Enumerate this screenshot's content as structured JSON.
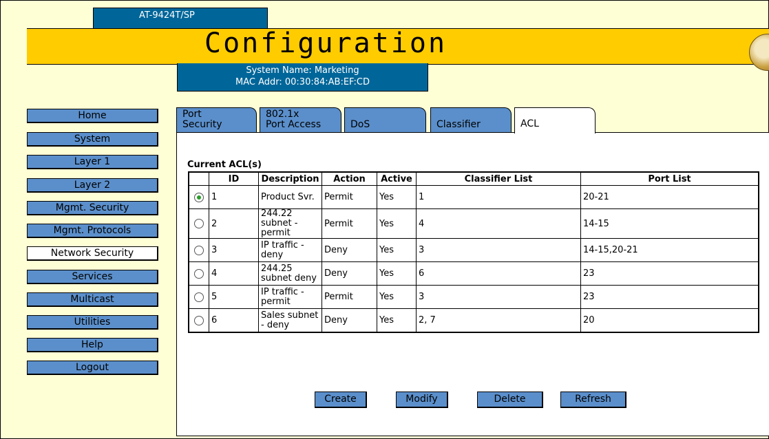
{
  "header": {
    "model": "AT-9424T/SP",
    "title": "Configuration",
    "system_name": "System Name: Marketing",
    "mac_addr": "MAC Addr: 00:30:84:AB:EF:CD"
  },
  "sidebar": {
    "items": [
      {
        "label": "Home"
      },
      {
        "label": "System"
      },
      {
        "label": "Layer 1"
      },
      {
        "label": "Layer 2"
      },
      {
        "label": "Mgmt. Security"
      },
      {
        "label": "Mgmt. Protocols"
      },
      {
        "label": "Network Security",
        "active": true
      },
      {
        "label": "Services"
      },
      {
        "label": "Multicast"
      },
      {
        "label": "Utilities"
      },
      {
        "label": "Help"
      },
      {
        "label": "Logout"
      }
    ]
  },
  "tabs": [
    {
      "line1": "Port",
      "line2": "Security"
    },
    {
      "line1": "802.1x",
      "line2": "Port Access"
    },
    {
      "line1": "",
      "line2": "DoS"
    },
    {
      "line1": "",
      "line2": "Classifier"
    },
    {
      "line1": "",
      "line2": "ACL",
      "active": true
    }
  ],
  "acl": {
    "caption": "Current ACL(s)",
    "columns": [
      "ID",
      "Description",
      "Action",
      "Active",
      "Classifier List",
      "Port List"
    ],
    "rows": [
      {
        "selected": true,
        "id": "1",
        "description": "Product Svr.",
        "action": "Permit",
        "active": "Yes",
        "classifiers": "1",
        "ports": "20-21"
      },
      {
        "selected": false,
        "id": "2",
        "description": "244.22 subnet - permit",
        "action": "Permit",
        "active": "Yes",
        "classifiers": "4",
        "ports": "14-15"
      },
      {
        "selected": false,
        "id": "3",
        "description": "IP traffic - deny",
        "action": "Deny",
        "active": "Yes",
        "classifiers": "3",
        "ports": "14-15,20-21"
      },
      {
        "selected": false,
        "id": "4",
        "description": "244.25 subnet deny",
        "action": "Deny",
        "active": "Yes",
        "classifiers": "6",
        "ports": "23"
      },
      {
        "selected": false,
        "id": "5",
        "description": "IP traffic - permit",
        "action": "Permit",
        "active": "Yes",
        "classifiers": "3",
        "ports": "23"
      },
      {
        "selected": false,
        "id": "6",
        "description": "Sales subnet - deny",
        "action": "Deny",
        "active": "Yes",
        "classifiers": "2, 7",
        "ports": "20"
      }
    ]
  },
  "actions": {
    "create": "Create",
    "modify": "Modify",
    "delete": "Delete",
    "refresh": "Refresh"
  },
  "colors": {
    "page_bg": "#ffffd6",
    "header_blue": "#006699",
    "title_gold": "#ffcc00",
    "button_blue": "#5b8fcb"
  }
}
